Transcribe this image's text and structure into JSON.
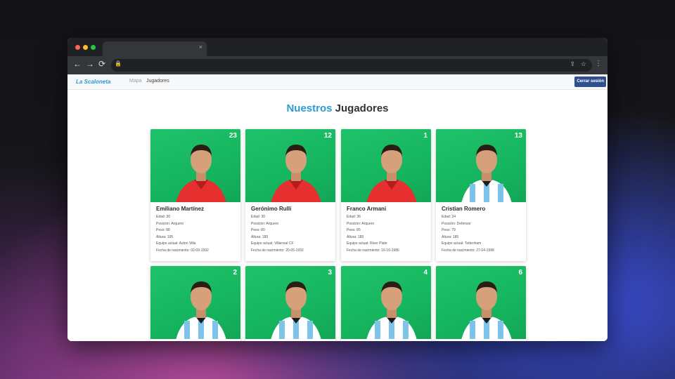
{
  "browser": {
    "tab_close": "×",
    "back": "←",
    "forward": "→",
    "reload": "⟳",
    "lock": "🔒",
    "share": "⇪",
    "star": "☆",
    "menu": "⋮"
  },
  "navbar": {
    "brand": "La Scaloneta",
    "links": [
      "Mapa",
      "Jugadores"
    ],
    "logout_label": "Cerrar sesión"
  },
  "page": {
    "title_a": "Nuestros",
    "title_b": "Jugadores"
  },
  "players": [
    {
      "number": "23",
      "name": "Emiliano Martínez",
      "kit": "keeper",
      "lines": [
        "Edad: 30",
        "Posición: Arquero",
        "Peso: 88",
        "Altura: 195",
        "Equipo actual: Aston Villa",
        "Fecha de nacimiento: 02-09-1992"
      ]
    },
    {
      "number": "12",
      "name": "Gerónimo Rulli",
      "kit": "keeper",
      "lines": [
        "Edad: 30",
        "Posición: Arquero",
        "Peso: 80",
        "Altura: 189",
        "Equipo actual: Villarreal CF",
        "Fecha de nacimiento: 20-05-1992"
      ]
    },
    {
      "number": "1",
      "name": "Franco Armani",
      "kit": "keeper",
      "lines": [
        "Edad: 36",
        "Posición: Arquero",
        "Peso: 85",
        "Altura: 189",
        "Equipo actual: River Plate",
        "Fecha de nacimiento: 16-10-1986"
      ]
    },
    {
      "number": "13",
      "name": "Cristian Romero",
      "kit": "outfield",
      "lines": [
        "Edad: 24",
        "Posición: Defensor",
        "Peso: 79",
        "Altura: 185",
        "Equipo actual: Tottenham",
        "Fecha de nacimiento: 27-04-1998"
      ]
    },
    {
      "number": "2",
      "name": "",
      "kit": "outfield",
      "lines": []
    },
    {
      "number": "3",
      "name": "",
      "kit": "outfield",
      "lines": []
    },
    {
      "number": "4",
      "name": "",
      "kit": "outfield",
      "lines": []
    },
    {
      "number": "6",
      "name": "",
      "kit": "outfield",
      "lines": []
    }
  ]
}
